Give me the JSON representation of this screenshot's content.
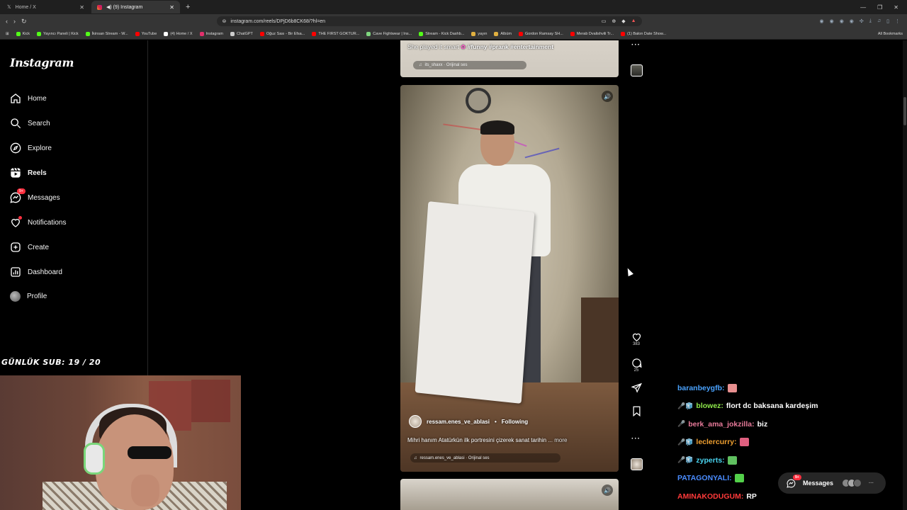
{
  "browser": {
    "tabs": [
      {
        "label": "Home / X",
        "active": false
      },
      {
        "label": "◀) (9) Instagram",
        "active": true
      }
    ],
    "url": "instagram.com/reels/DPjD6b8CK68/?hl=en",
    "bookmarks": [
      {
        "label": "Kick",
        "color": "#53fc18"
      },
      {
        "label": "Yayıncı Paneli | Kick",
        "color": "#53fc18"
      },
      {
        "label": "İkinsan Stream - W...",
        "color": "#53fc18"
      },
      {
        "label": "YouTube",
        "color": "#ff0000"
      },
      {
        "label": "(4) Home / X",
        "color": "#ffffff"
      },
      {
        "label": "Instagram",
        "color": "#e1306c"
      },
      {
        "label": "ChatGPT",
        "color": "#cccccc"
      },
      {
        "label": "Oğuz Sası - Bir Efsa...",
        "color": "#ff0000"
      },
      {
        "label": "THE FIRST GOKTUR...",
        "color": "#ff0000"
      },
      {
        "label": "Cave Fightwear | Ins...",
        "color": "#7fd67f"
      },
      {
        "label": "Stream - Kick Dashb...",
        "color": "#53fc18"
      },
      {
        "label": "yayın",
        "color": "#e0b040"
      },
      {
        "label": "Albüm",
        "color": "#e0b040"
      },
      {
        "label": "Gordon Ramsay SH...",
        "color": "#ff0000"
      },
      {
        "label": "Merab Dvalishvili Tr...",
        "color": "#ff0000"
      },
      {
        "label": "(1) Balon Date Show...",
        "color": "#ff0000"
      }
    ],
    "all_bookmarks": "All Bookmarks"
  },
  "sidebar": {
    "logo": "Instagram",
    "items": [
      {
        "label": "Home",
        "icon": "home-icon"
      },
      {
        "label": "Search",
        "icon": "search-icon"
      },
      {
        "label": "Explore",
        "icon": "explore-icon"
      },
      {
        "label": "Reels",
        "icon": "reels-icon"
      },
      {
        "label": "Messages",
        "icon": "messages-icon",
        "badge": "9+"
      },
      {
        "label": "Notifications",
        "icon": "heart-icon"
      },
      {
        "label": "Create",
        "icon": "create-icon"
      },
      {
        "label": "Dashboard",
        "icon": "dashboard-icon"
      },
      {
        "label": "Profile",
        "icon": "avatar"
      }
    ]
  },
  "stream_overlay": {
    "sub_goal": "GÜNLÜK SUB: 19 / 20"
  },
  "reels": {
    "previous": {
      "caption_text": "She played it smart",
      "caption_tags": "#funny #prank #entertainment",
      "audio": "its_shaxx · Orijinal ses"
    },
    "current": {
      "author": "ressam.enes_ve_ablasi",
      "separator": "•",
      "follow_status": "Following",
      "caption": "Mihri hanım Atatürkün ilk portresini çizerek sanat tarihin",
      "more": "... more",
      "audio": "ressam.enes_ve_ablasi · Orijinal ses",
      "likes": "383",
      "comments": "25"
    }
  },
  "chat": [
    {
      "user": "baranbeygfb:",
      "color": "#4aa3ff",
      "message": "",
      "emote": "#e89090",
      "badges": ""
    },
    {
      "user": "blowez:",
      "color": "#8ee94a",
      "message": "flort dc baksana kardeşim",
      "emote": "",
      "badges": "🎤🧊"
    },
    {
      "user": "berk_ama_jokzilla:",
      "color": "#e87a9a",
      "message": "biz",
      "emote": "",
      "badges": "🎤"
    },
    {
      "user": "leclercurry:",
      "color": "#f0a030",
      "message": "",
      "emote": "#e06080",
      "badges": "🎤🧊"
    },
    {
      "user": "zyperts:",
      "color": "#4ad4f0",
      "message": "",
      "emote": "#60c060",
      "badges": "🎤🧊"
    },
    {
      "user": "PATAGONYALI:",
      "color": "#4a8cff",
      "message": "",
      "emote": "#53d04a",
      "badges": ""
    },
    {
      "user": "AMINAKODUGUM:",
      "color": "#ff3a3a",
      "message": "RP",
      "emote": "",
      "badges": ""
    }
  ],
  "messages_pill": {
    "label": "Messages",
    "badge": "9+"
  }
}
